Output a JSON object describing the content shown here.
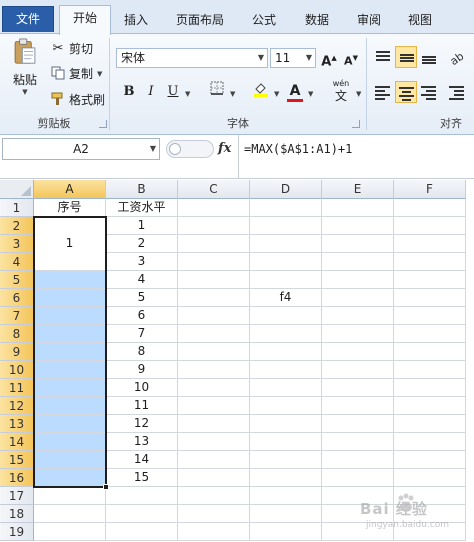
{
  "ribbon": {
    "tabs": [
      "文件",
      "开始",
      "插入",
      "页面布局",
      "公式",
      "数据",
      "审阅",
      "视图"
    ],
    "active_tab": "开始",
    "clipboard": {
      "paste": "粘贴",
      "cut": "剪切",
      "copy": "复制",
      "format_painter": "格式刷",
      "group_label": "剪贴板"
    },
    "font": {
      "name": "宋体",
      "size": "11",
      "bold": "B",
      "italic": "I",
      "underline": "U",
      "grow": "A",
      "shrink": "A",
      "font_color_glyph": "A",
      "phonetic_glyph": "wén",
      "phonetic_char": "文",
      "group_label": "字体"
    },
    "alignment": {
      "group_label": "对齐"
    }
  },
  "formula_bar": {
    "name_box": "A2",
    "fx": "fx",
    "formula": "=MAX($A$1:A1)+1"
  },
  "sheet": {
    "columns": [
      "A",
      "B",
      "C",
      "D",
      "E",
      "F"
    ],
    "rows": [
      "1",
      "2",
      "3",
      "4",
      "5",
      "6",
      "7",
      "8",
      "9",
      "10",
      "11",
      "12",
      "13",
      "14",
      "15",
      "16",
      "17",
      "18",
      "19"
    ],
    "header_row": {
      "A": "序号",
      "B": "工资水平"
    },
    "a2_value": "1",
    "b_values": [
      "1",
      "2",
      "3",
      "4",
      "5",
      "6",
      "7",
      "8",
      "9",
      "10",
      "11",
      "12",
      "13",
      "14",
      "15"
    ],
    "d6_value": "f4",
    "selection": "A2:A16"
  },
  "watermark": {
    "text": "Bai 经验",
    "sub": "jingyan.baidu.com"
  },
  "colors": {
    "selection_fill": "#bcdcff",
    "header_highlight": "#f4c55b",
    "file_tab": "#2a5ea8"
  }
}
